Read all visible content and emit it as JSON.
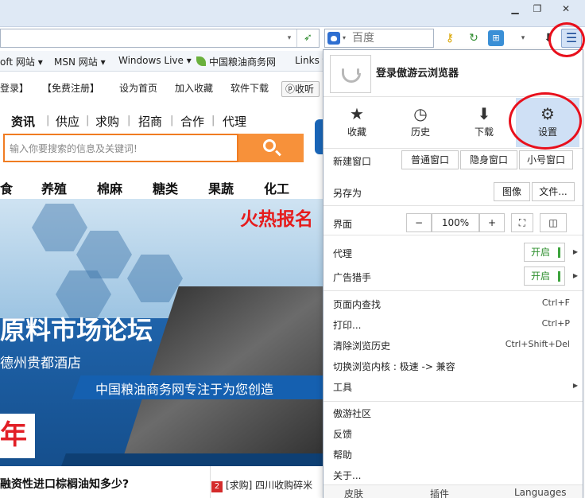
{
  "toolbar": {
    "search_placeholder": "百度"
  },
  "bookmarks": [
    "oft 网站 ▾",
    "MSN 网站 ▾",
    "Windows Live ▾",
    "中国粮油商务网",
    "Links ▾"
  ],
  "webpage": {
    "topnav": [
      "登录】",
      "【免费注册】",
      "设为首页",
      "加入收藏",
      "软件下载"
    ],
    "listen_button": "收听",
    "categories": [
      "资讯",
      "供应",
      "求购",
      "招商",
      "合作",
      "代理"
    ],
    "search_placeholder": "输入你要搜索的信息及关键词!",
    "menu": [
      "食",
      "养殖",
      "棉麻",
      "糖类",
      "果蔬",
      "化工"
    ],
    "banner": {
      "hot_tag": "火热报名",
      "title": "原料市场论坛",
      "venue": "德州贵都酒店",
      "slogan": "中国粮油商务网专注于为您创造",
      "year": "年"
    },
    "headline": "融资性进口棕榈油知多少?",
    "news_item_num": "2",
    "news_item": "[求购] 四川收购碎米"
  },
  "menu": {
    "login_label": "登录傲游云浏览器",
    "quick_actions": [
      {
        "label": "收藏",
        "icon": "★"
      },
      {
        "label": "历史",
        "icon": "◷"
      },
      {
        "label": "下载",
        "icon": "⬇"
      },
      {
        "label": "设置",
        "icon": "⚙"
      }
    ],
    "new_window_label": "新建窗口",
    "new_window_options": [
      "普通窗口",
      "隐身窗口",
      "小号窗口"
    ],
    "save_as_label": "另存为",
    "save_as_options": [
      "图像",
      "文件..."
    ],
    "ui_label": "界面",
    "zoom_minus": "−",
    "zoom_level": "100%",
    "zoom_plus": "+",
    "proxy_label": "代理",
    "proxy_state": "开启",
    "adblock_label": "广告猎手",
    "adblock_state": "开启",
    "items": [
      {
        "label": "页面内查找",
        "shortcut": "Ctrl+F"
      },
      {
        "label": "打印...",
        "shortcut": "Ctrl+P"
      },
      {
        "label": "清除浏览历史",
        "shortcut": "Ctrl+Shift+Del"
      },
      {
        "label": "切换浏览内核 : 极速 -> 兼容",
        "shortcut": ""
      },
      {
        "label": "工具",
        "shortcut": ""
      }
    ],
    "community_items": [
      "傲游社区",
      "反馈",
      "帮助",
      "关于..."
    ],
    "bottom_items": [
      "皮肤",
      "插件",
      "Languages"
    ]
  }
}
